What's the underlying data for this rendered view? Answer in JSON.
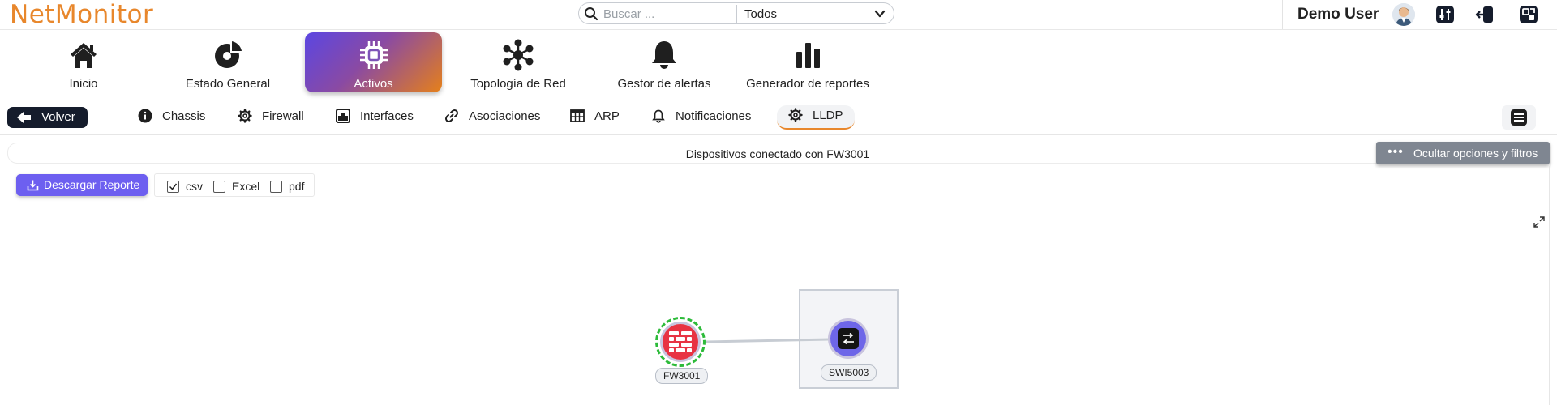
{
  "app": {
    "brand": "NetMonitor",
    "brand_color": "#e8872c"
  },
  "search": {
    "placeholder": "Buscar ...",
    "value": "",
    "scope_value": "Todos"
  },
  "user": {
    "name": "Demo User"
  },
  "header_icons": [
    "avatar-icon",
    "sliders-icon",
    "logout-icon",
    "switch-view-icon"
  ],
  "main_nav": {
    "items": [
      {
        "label": "Inicio",
        "icon": "home-icon"
      },
      {
        "label": "Estado General",
        "icon": "pie-chart-icon"
      },
      {
        "label": "Activos",
        "icon": "chip-icon",
        "active": true
      },
      {
        "label": "Topología de Red",
        "icon": "network-icon"
      },
      {
        "label": "Gestor de alertas",
        "icon": "bell-icon"
      },
      {
        "label": "Generador de reportes",
        "icon": "bar-chart-icon"
      }
    ]
  },
  "sub_nav": {
    "back_label": "Volver",
    "tabs": [
      {
        "label": "Chassis",
        "icon": "info-icon"
      },
      {
        "label": "Firewall",
        "icon": "gear-icon"
      },
      {
        "label": "Interfaces",
        "icon": "interface-icon"
      },
      {
        "label": "Asociaciones",
        "icon": "link-icon"
      },
      {
        "label": "ARP",
        "icon": "table-icon"
      },
      {
        "label": "Notificaciones",
        "icon": "bell-small-icon"
      },
      {
        "label": "LLDP",
        "icon": "gear-icon",
        "active": true
      }
    ],
    "active_tab_underline_color": "#e8872c"
  },
  "content": {
    "title": "Dispositivos conectado con FW3001",
    "toggle_label": "Ocultar opciones y filtros",
    "toggle_dots": "•••",
    "download_label": "Descargar Reporte",
    "formats": [
      {
        "label": "csv",
        "checked": true
      },
      {
        "label": "Excel",
        "checked": false
      },
      {
        "label": "pdf",
        "checked": false
      }
    ]
  },
  "topology": {
    "nodes": [
      {
        "label": "FW3001",
        "type": "firewall",
        "color": "#e83343",
        "status_ring_color": "#2dbb3a"
      },
      {
        "label": "SWI5003",
        "type": "switch",
        "color": "#6e66e8"
      }
    ],
    "links": [
      {
        "from": "FW3001",
        "to": "SWI5003"
      }
    ]
  },
  "colors": {
    "active_nav_gradient": [
      "#5b46e2",
      "#e5801a"
    ],
    "download_button": "#6d5ff0",
    "back_button": "#151c2c",
    "toggle_button": "#7f8691"
  }
}
